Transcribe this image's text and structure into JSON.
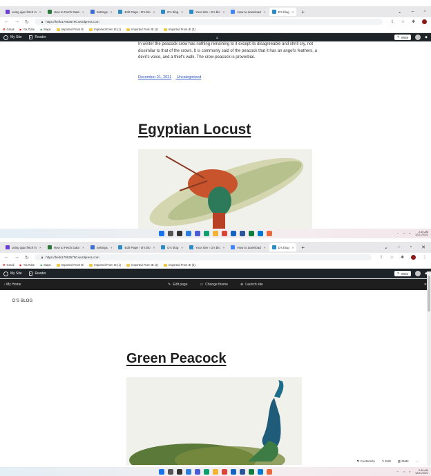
{
  "frame1": {
    "tabs": [
      {
        "label": "using ajax fetch in",
        "color": "#6a3fd1"
      },
      {
        "label": "How to Fetch Data",
        "color": "#2b7a3b"
      },
      {
        "label": "Settings",
        "color": "#3b6fd6"
      },
      {
        "label": "Edit Page ‹ D's blo",
        "color": "#2c8bc5"
      },
      {
        "label": "D's blog",
        "color": "#2c8bc5"
      },
      {
        "label": "Your Site ‹ D's blo",
        "color": "#2c8bc5"
      },
      {
        "label": "How to download",
        "color": "#4285f4"
      },
      {
        "label": "D's blog",
        "color": "#2c8bc5"
      }
    ],
    "url": "https://hello179535790.wordpress.com",
    "bookmarks": [
      "Gmail",
      "YouTube",
      "Maps",
      "Imported From IE",
      "Imported From IE (1)",
      "Imported From IE (2)",
      "Imported From IE (3)"
    ],
    "admin": {
      "my_site": "My Site",
      "reader": "Reader",
      "write": "Write"
    },
    "paragraph": "In winter the peacock-crow has nothing remaining to it except its disagreeable and shrill cry, not dissimilar to that of the crows. It is commonly said of the peacock that it has an angel's feathers, a devil's voice, and a thief's walk. The crow-peacock is proverbial.",
    "date": "December 21, 2021",
    "category": "Uncategorized",
    "post_title": "Egyptian Locust",
    "clock": {
      "time": "2:40 AM",
      "date": "12/21/2021"
    }
  },
  "frame2": {
    "tabs": [
      {
        "label": "using ajax fetch in",
        "color": "#6a3fd1"
      },
      {
        "label": "How to Fetch Data",
        "color": "#2b7a3b"
      },
      {
        "label": "Settings",
        "color": "#3b6fd6"
      },
      {
        "label": "Edit Page ‹ D's blo",
        "color": "#2c8bc5"
      },
      {
        "label": "D's blog",
        "color": "#2c8bc5"
      },
      {
        "label": "Your Site ‹ D's blo",
        "color": "#2c8bc5"
      },
      {
        "label": "How to download",
        "color": "#4285f4"
      },
      {
        "label": "D's blog",
        "color": "#2c8bc5"
      }
    ],
    "url": "https://hello179535790.wordpress.com",
    "bookmarks": [
      "Gmail",
      "YouTube",
      "Maps",
      "Imported From IE",
      "Imported From IE (1)",
      "Imported From IE (2)",
      "Imported From IE (3)"
    ],
    "admin": {
      "my_site": "My Site",
      "reader": "Reader",
      "write": "Write"
    },
    "editbar": {
      "my_home": "My Home",
      "edit_page": "Edit page",
      "change_theme": "Change theme",
      "launch_site": "Launch site"
    },
    "site_title": "D'S BLOG",
    "post_title": "Green Peacock",
    "floating": {
      "customize": "Customize",
      "edit": "Edit",
      "stats": "Stats"
    },
    "clock": {
      "time": "2:40 AM",
      "date": "12/21/2021"
    }
  }
}
